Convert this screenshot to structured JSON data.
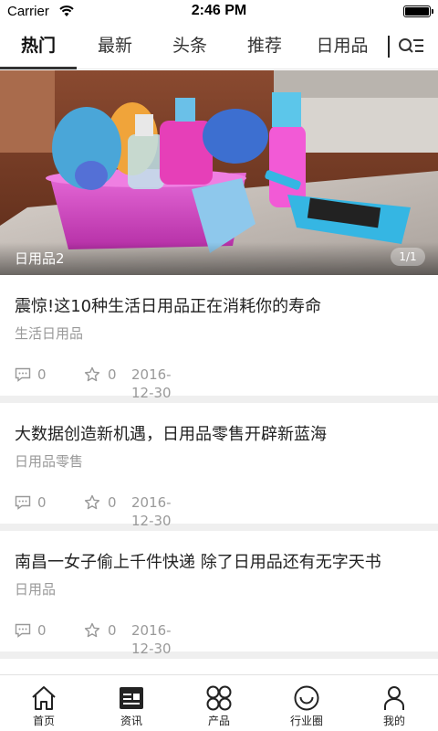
{
  "status_bar": {
    "carrier": "Carrier",
    "time": "2:46 PM"
  },
  "tabs": [
    {
      "label": "热门",
      "active": true
    },
    {
      "label": "最新",
      "active": false
    },
    {
      "label": "头条",
      "active": false
    },
    {
      "label": "推荐",
      "active": false
    },
    {
      "label": "日用品",
      "active": false
    }
  ],
  "tab_menu_icon": "search-list-icon",
  "banner": {
    "caption": "日用品2",
    "pager": "1/1"
  },
  "articles": [
    {
      "title": "震惊!这10种生活日用品正在消耗你的寿命",
      "category": "生活日用品",
      "comments": "0",
      "favorites": "0",
      "date": "2016-12-30"
    },
    {
      "title": "大数据创造新机遇，日用品零售开辟新蓝海",
      "category": "日用品零售",
      "comments": "0",
      "favorites": "0",
      "date": "2016-12-30"
    },
    {
      "title": "南昌一女子偷上千件快递 除了日用品还有无字天书",
      "category": "日用品",
      "comments": "0",
      "favorites": "0",
      "date": "2016-12-30"
    }
  ],
  "bottom_nav": [
    {
      "label": "首页",
      "icon": "home-icon"
    },
    {
      "label": "资讯",
      "icon": "news-icon"
    },
    {
      "label": "产品",
      "icon": "grid-icon"
    },
    {
      "label": "行业圈",
      "icon": "smile-circle-icon"
    },
    {
      "label": "我的",
      "icon": "user-icon"
    }
  ],
  "colors": {
    "text": "#222222",
    "muted": "#999999",
    "separator": "#efefef",
    "underline": "#333333"
  }
}
